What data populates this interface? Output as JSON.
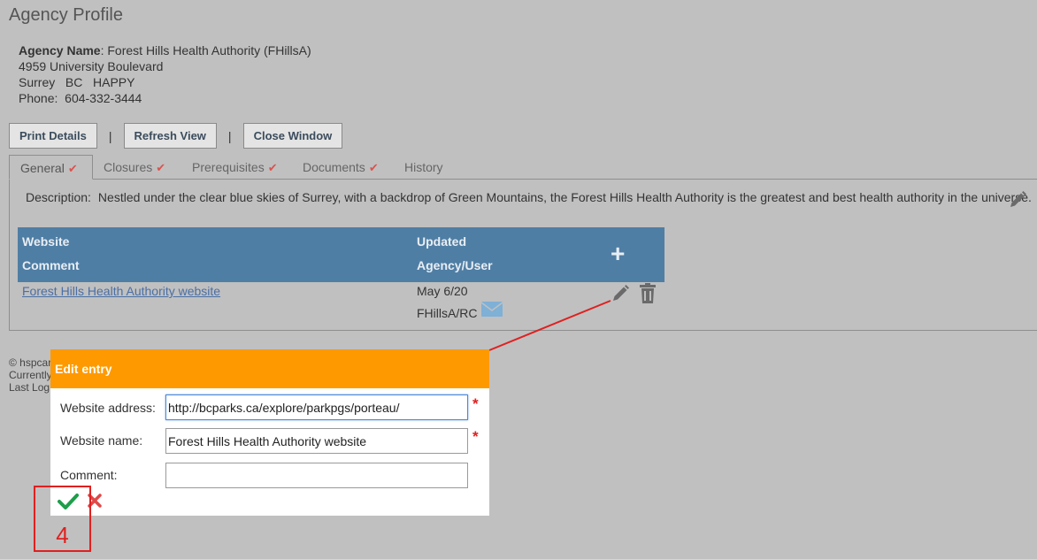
{
  "page": {
    "title": "Agency Profile"
  },
  "agency": {
    "name_label": "Agency Name",
    "name_value": ": Forest Hills Health Authority (FHillsA)",
    "address": "4959 University Boulevard",
    "city_line": "Surrey   BC   HAPPY",
    "phone_line": "Phone:  604-332-3444"
  },
  "toolbar": {
    "print_label": "Print Details",
    "refresh_label": "Refresh View",
    "close_label": "Close Window",
    "separator": "|"
  },
  "tabs": [
    {
      "label": "General",
      "checked": true,
      "active": true
    },
    {
      "label": "Closures",
      "checked": true
    },
    {
      "label": "Prerequisites",
      "checked": true
    },
    {
      "label": "Documents",
      "checked": true
    },
    {
      "label": "History",
      "checked": false
    }
  ],
  "tab_check": "✔",
  "description": {
    "label": "Description:",
    "text": "Nestled under the clear blue skies of Surrey, with a backdrop of Green Mountains, the Forest Hills Health Authority is the greatest and best health authority in the universe."
  },
  "grid": {
    "headers": {
      "website": "Website",
      "comment": "Comment",
      "updated": "Updated",
      "agency_user": "Agency/User",
      "add": "+"
    },
    "rows": [
      {
        "website": "Forest Hills Health Authority website",
        "date": "May 6/20",
        "user": "FHillsA/RC"
      }
    ]
  },
  "footer": {
    "line1": "© hspcar",
    "line2": "Currently",
    "line3": "Last Log"
  },
  "dialog": {
    "title": "Edit entry",
    "fields": [
      {
        "label": "Website address:",
        "value": "http://bcparks.ca/explore/parkpgs/porteau/",
        "required": true
      },
      {
        "label": "Website name:",
        "value": "Forest Hills Health Authority website",
        "required": true
      },
      {
        "label": "Comment:",
        "value": "",
        "required": false
      }
    ],
    "required_mark": "*"
  },
  "annotation": {
    "step_number": "4"
  },
  "colors": {
    "accent_orange": "#ff9900",
    "grid_header": "#4f7ea4",
    "annotation_red": "#e02020",
    "confirm_green": "#1e9e4a"
  }
}
